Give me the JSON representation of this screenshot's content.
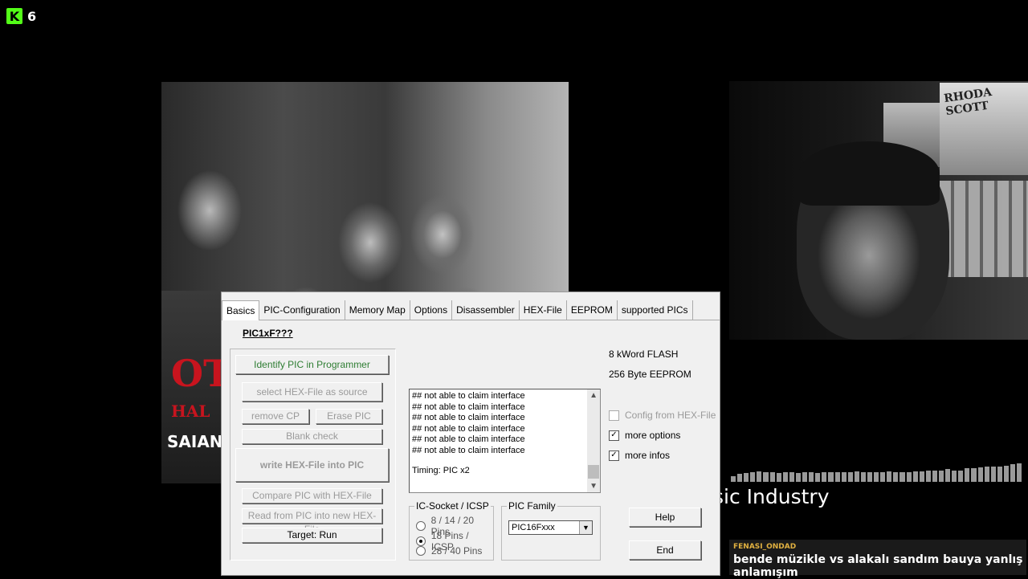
{
  "overlay": {
    "logo_letter": "K",
    "viewer_count": "6",
    "red_title": "OT",
    "red_subtitle": "HAL",
    "artist": "SAIAN",
    "caption": "sic Industry",
    "chat": {
      "user": "FENASI_ONDAD",
      "message": "bende müzikle vs alakalı sandım bauya yanlış anlamışım"
    },
    "audio_levels": [
      0.3,
      0.4,
      0.45,
      0.5,
      0.55,
      0.5,
      0.5,
      0.45,
      0.5,
      0.5,
      0.45,
      0.5,
      0.5,
      0.45,
      0.5,
      0.5,
      0.5,
      0.5,
      0.5,
      0.55,
      0.5,
      0.5,
      0.5,
      0.5,
      0.55,
      0.5,
      0.5,
      0.5,
      0.55,
      0.55,
      0.6,
      0.6,
      0.6,
      0.65,
      0.6,
      0.6,
      0.7,
      0.7,
      0.75,
      0.8,
      0.8,
      0.8,
      0.85,
      0.9,
      0.95
    ]
  },
  "poster": {
    "text": "RHODA SCOTT"
  },
  "dialog": {
    "tabs": [
      "Basics",
      "PIC-Configuration",
      "Memory Map",
      "Options",
      "Disassembler",
      "HEX-File",
      "EEPROM",
      "supported PICs"
    ],
    "pic_id": "PIC1xF???",
    "buttons": {
      "identify": "Identify PIC in Programmer",
      "select_hex": "select HEX-File as source",
      "remove_cp": "remove CP",
      "erase_pic": "Erase PIC",
      "blank_check": "Blank check",
      "write_hex": "write HEX-File into PIC",
      "compare": "Compare PIC with HEX-File",
      "read_from": "Read from PIC into new HEX-File",
      "target_run": "Target: Run",
      "help": "Help",
      "end": "End"
    },
    "flash_info": "8 kWord FLASH",
    "eeprom_info": "256 Byte EEPROM",
    "log": {
      "lines": [
        "## not able to claim interface",
        "## not able to claim interface",
        "## not able to claim interface",
        "## not able to claim interface",
        "## not able to claim interface",
        "## not able to claim interface"
      ],
      "timing": "Timing: PIC x2"
    },
    "checkboxes": {
      "config_from_hex": {
        "label": "Config from HEX-File",
        "checked": false
      },
      "more_options": {
        "label": "more options",
        "checked": true
      },
      "more_infos": {
        "label": "more infos",
        "checked": true
      }
    },
    "ic_socket": {
      "legend": "IC-Socket / ICSP",
      "options": [
        "8 / 14 / 20 Pins",
        "18 Pins / ICSP",
        "28 / 40 Pins"
      ],
      "selected": "18 Pins / ICSP"
    },
    "pic_family": {
      "legend": "PIC Family",
      "value": "PIC16Fxxx"
    }
  }
}
